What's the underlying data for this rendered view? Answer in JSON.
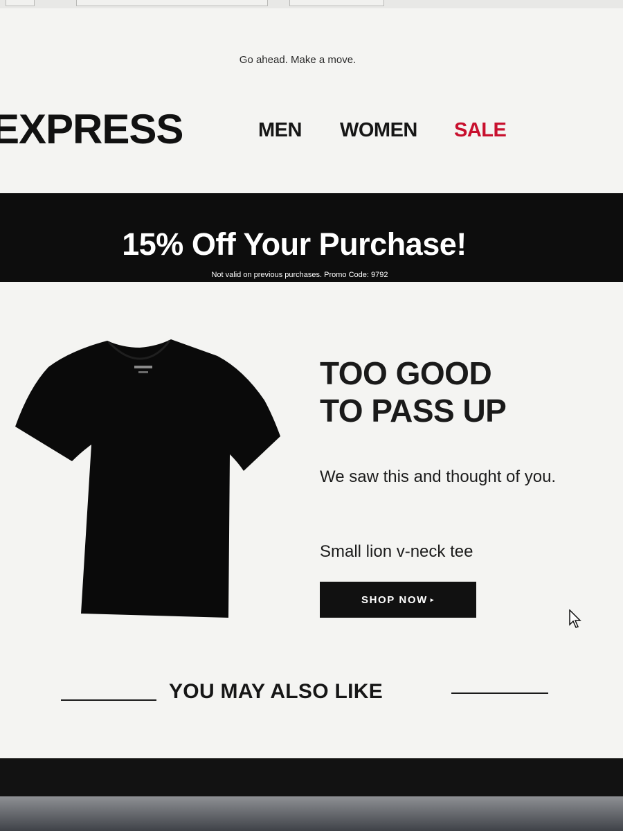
{
  "email": {
    "preheader": "Go ahead. Make a move.",
    "logo": "EXPRESS",
    "nav": {
      "men": "MEN",
      "women": "WOMEN",
      "sale": "SALE"
    },
    "promo": {
      "title": "15% Off Your Purchase!",
      "note": "Not valid on previous purchases. Promo Code: 9792"
    },
    "feature": {
      "headline_line1": "TOO GOOD",
      "headline_line2": "TO PASS UP",
      "blurb": "We saw this and thought of you.",
      "product_name": "Small lion v-neck tee",
      "button_label": "SHOP NOW",
      "button_caret": "▸"
    },
    "section_heading": "YOU MAY ALSO LIKE"
  },
  "colors": {
    "sale": "#c8102e",
    "banner": "#0d0d0d",
    "button": "#111111",
    "page_background": "#f4f4f2"
  },
  "icons": {
    "product_image": "t-shirt-icon",
    "pointer": "mouse-cursor-icon"
  }
}
